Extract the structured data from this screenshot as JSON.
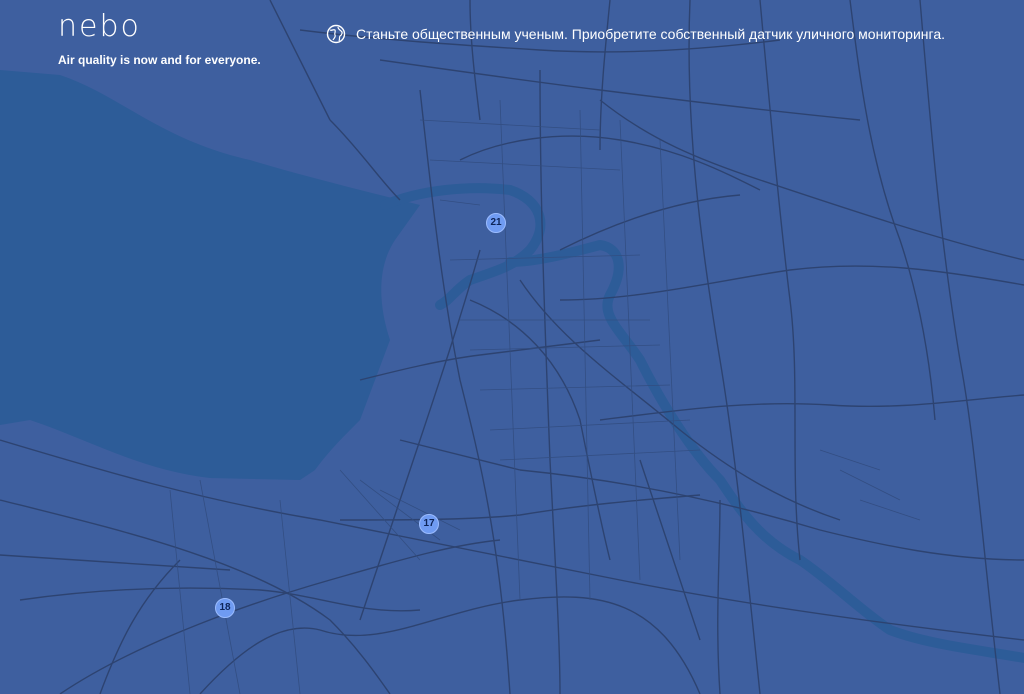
{
  "brand": {
    "logo_text": "nebo",
    "tagline": "Air quality is now and for everyone."
  },
  "promo": {
    "icon": "globe-icon",
    "text": "Станьте общественным ученым. Приобретите собственный датчик уличного мониторинга."
  },
  "map": {
    "clusters": [
      {
        "count": "21"
      },
      {
        "count": "17"
      },
      {
        "count": "18"
      }
    ]
  },
  "colors": {
    "land": "#3e5f9f",
    "water": "#2d5c98",
    "roads": "#2c416d",
    "river": "#2d5c98",
    "marker": "#6f9bf2",
    "text": "#ffffff"
  }
}
